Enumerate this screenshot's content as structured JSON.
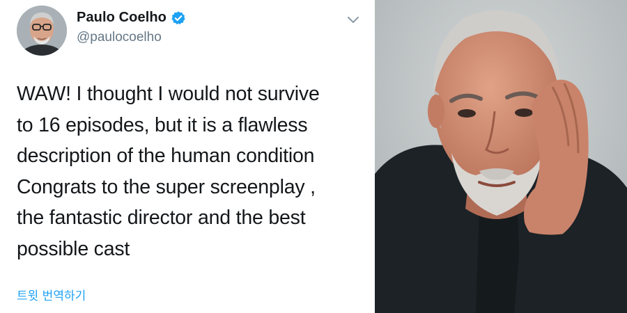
{
  "tweet": {
    "display_name": "Paulo Coelho",
    "handle": "@paulocoelho",
    "verified_icon": "verified-badge-icon",
    "menu_icon": "chevron-down-icon",
    "text_lines": [
      "WAW! I thought I would not survive",
      "to 16 episodes, but it is a flawless",
      "description of the human condition",
      "Congrats to the super screenplay ,",
      "the fantastic director and the best",
      "possible cast"
    ],
    "translate_label": "트윗 번역하기"
  },
  "colors": {
    "text": "#14171a",
    "secondary": "#657786",
    "link": "#1da1f2",
    "verified": "#1da1f2",
    "photo_background": "#c4c8c9",
    "sweater": "#1c2226"
  }
}
